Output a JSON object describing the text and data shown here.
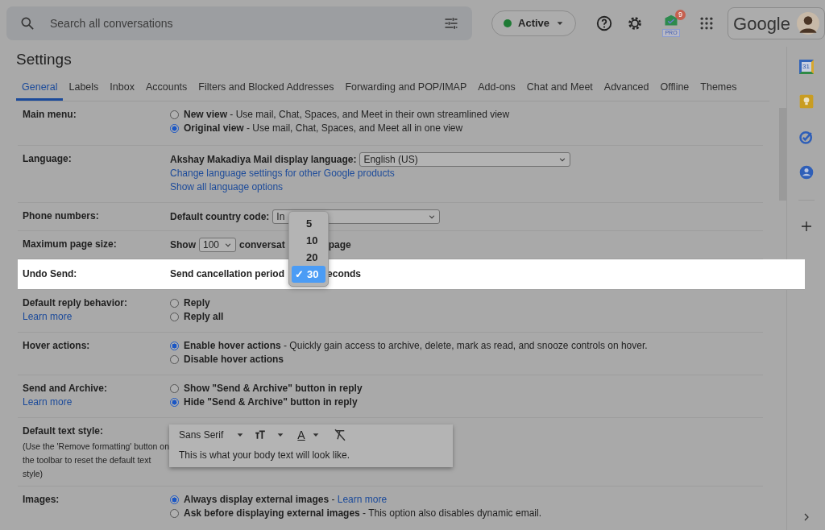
{
  "topbar": {
    "search": {
      "placeholder": "Search all conversations"
    },
    "status": {
      "label": "Active",
      "color": "#1e7a34"
    },
    "addon": {
      "badge": "9",
      "tag": "PRO"
    },
    "account": {
      "logo": "Google"
    }
  },
  "title": "Settings",
  "tabs": [
    {
      "label": "General",
      "selected": true
    },
    {
      "label": "Labels",
      "selected": false
    },
    {
      "label": "Inbox",
      "selected": false
    },
    {
      "label": "Accounts",
      "selected": false
    },
    {
      "label": "Filters and Blocked Addresses",
      "selected": false
    },
    {
      "label": "Forwarding and POP/IMAP",
      "selected": false
    },
    {
      "label": "Add-ons",
      "selected": false
    },
    {
      "label": "Chat and Meet",
      "selected": false
    },
    {
      "label": "Advanced",
      "selected": false
    },
    {
      "label": "Offline",
      "selected": false
    },
    {
      "label": "Themes",
      "selected": false
    }
  ],
  "rows": [
    {
      "kind": "radio",
      "label": "Main menu:",
      "highlighted": false,
      "options": [
        {
          "label": "New view",
          "desc": " - Use mail, Chat, Spaces, and Meet in their own streamlined view",
          "selected": false
        },
        {
          "label": "Original view",
          "desc": " - Use mail, Chat, Spaces, and Meet all in one view",
          "selected": true
        }
      ]
    },
    {
      "kind": "language",
      "label": "Language:",
      "highlighted": false,
      "prompt": "Akshay Makadiya Mail display language:",
      "value": "English (US)",
      "links": [
        "Change language settings for other Google products",
        "Show all language options"
      ]
    },
    {
      "kind": "select",
      "label": "Phone numbers:",
      "highlighted": false,
      "prompt": "Default country code:",
      "value": "In"
    },
    {
      "kind": "pagesize",
      "label": "Maximum page size:",
      "highlighted": false,
      "prompt": "Show",
      "value": "100",
      "after": "conversat",
      "tail": "page"
    },
    {
      "kind": "undo",
      "label": "Undo Send:",
      "highlighted": true,
      "prompt": "Send cancellation period",
      "tail": "econds",
      "choices": [
        {
          "label": "5",
          "selected": false
        },
        {
          "label": "10",
          "selected": false
        },
        {
          "label": "20",
          "selected": false
        },
        {
          "label": "30",
          "selected": true
        }
      ],
      "check": "✓"
    },
    {
      "kind": "radio",
      "label": "Default reply behavior:",
      "link": "Learn more",
      "highlighted": false,
      "options": [
        {
          "label": "Reply",
          "selected": false
        },
        {
          "label": "Reply all",
          "selected": false
        }
      ]
    },
    {
      "kind": "radio",
      "label": "Hover actions:",
      "highlighted": false,
      "options": [
        {
          "label": "Enable hover actions",
          "desc": " - Quickly gain access to archive, delete, mark as read, and snooze controls on hover.",
          "selected": true
        },
        {
          "label": "Disable hover actions",
          "selected": false
        }
      ]
    },
    {
      "kind": "radio",
      "label": "Send and Archive:",
      "link": "Learn more",
      "highlighted": false,
      "options": [
        {
          "label": "Show \"Send & Archive\" button in reply",
          "selected": false
        },
        {
          "label": "Hide \"Send & Archive\" button in reply",
          "selected": true
        }
      ]
    },
    {
      "kind": "textstyle",
      "label": "Default text style:",
      "note": "(Use the 'Remove formatting' button on the toolbar to reset the default text style)",
      "highlighted": false,
      "font": "Sans Serif",
      "color_glyph": "A",
      "preview": "This is what your body text will look like."
    },
    {
      "kind": "radio",
      "label": "Images:",
      "highlighted": false,
      "options": [
        {
          "label": "Always display external images",
          "desc": " - ",
          "link": "Learn more",
          "selected": true
        },
        {
          "label": "Ask before displaying external images",
          "desc": " - This option also disables dynamic email.",
          "selected": false
        }
      ]
    }
  ],
  "side_panel": {
    "calendar_day": "31"
  }
}
